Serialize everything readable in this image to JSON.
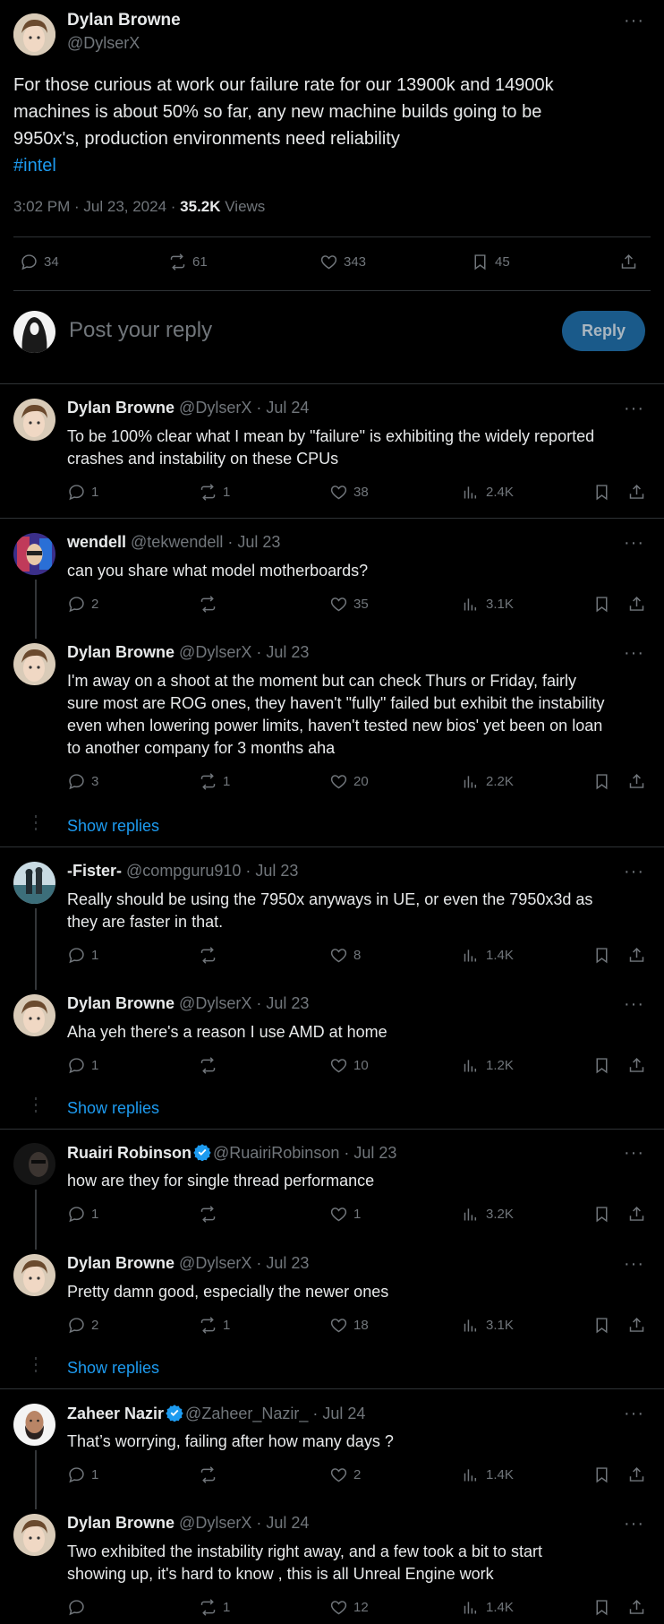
{
  "main": {
    "author_name": "Dylan Browne",
    "author_handle": "@DylserX",
    "text_line1": "For those curious at work our failure rate for our 13900k and 14900k",
    "text_line2": "machines is about 50% so far, any new machine builds going to be",
    "text_line3": "9950x's, production environments need reliability",
    "hashtag": "#intel",
    "time": "3:02 PM · Jul 23, 2024 · ",
    "views_count": "35.2K",
    "views_label": " Views",
    "replies": "34",
    "reposts": "61",
    "likes": "343",
    "bookmarks": "45"
  },
  "composer": {
    "placeholder": "Post your reply",
    "reply_button": "Reply"
  },
  "show_replies_label": "Show replies",
  "replies": [
    {
      "name": "Dylan Browne",
      "handle": "@DylserX · Jul 24",
      "lines": [
        "To be 100% clear what I mean by \"failure\" is exhibiting the widely reported",
        "crashes and instability on these CPUs"
      ],
      "reply_count": "1",
      "repost_count": "1",
      "like_count": "38",
      "view_count": "2.4K"
    },
    {
      "name": "wendell",
      "handle": "@tekwendell · Jul 23",
      "lines": [
        "can you share what model motherboards?"
      ],
      "reply_count": "2",
      "repost_count": "",
      "like_count": "35",
      "view_count": "3.1K"
    },
    {
      "name": "Dylan Browne",
      "handle": "@DylserX · Jul 23",
      "lines": [
        "I'm away on a shoot at the moment but can check Thurs or Friday, fairly",
        "sure most are ROG ones, they haven't \"fully\" failed but exhibit the instability",
        "even when lowering power limits, haven't tested new bios' yet been on loan",
        "to another company for 3 months aha"
      ],
      "reply_count": "3",
      "repost_count": "1",
      "like_count": "20",
      "view_count": "2.2K"
    },
    {
      "name": "-Fister-",
      "handle": "@compguru910 · Jul 23",
      "lines": [
        "Really should be using the 7950x anyways in UE, or even the 7950x3d as",
        "they are faster in that."
      ],
      "reply_count": "1",
      "repost_count": "",
      "like_count": "8",
      "view_count": "1.4K"
    },
    {
      "name": "Dylan Browne",
      "handle": "@DylserX · Jul 23",
      "lines": [
        "Aha yeh there's a reason I use AMD at home"
      ],
      "reply_count": "1",
      "repost_count": "",
      "like_count": "10",
      "view_count": "1.2K"
    },
    {
      "name": "Ruairi Robinson",
      "handle": "@RuairiRobinson · Jul 23",
      "lines": [
        "how are they for single thread performance"
      ],
      "reply_count": "1",
      "repost_count": "",
      "like_count": "1",
      "view_count": "3.2K"
    },
    {
      "name": "Dylan Browne",
      "handle": "@DylserX · Jul 23",
      "lines": [
        "Pretty damn good, especially the newer ones"
      ],
      "reply_count": "2",
      "repost_count": "1",
      "like_count": "18",
      "view_count": "3.1K"
    },
    {
      "name": "Zaheer Nazir",
      "handle": "@Zaheer_Nazir_ · Jul 24",
      "lines": [
        "That’s worrying, failing after how many days ?"
      ],
      "reply_count": "1",
      "repost_count": "",
      "like_count": "2",
      "view_count": "1.4K"
    },
    {
      "name": "Dylan Browne",
      "handle": "@DylserX · Jul 24",
      "lines": [
        "Two exhibited the instability right away, and a few took a bit to start",
        "showing up, it's hard to know , this is all Unreal Engine work"
      ],
      "reply_count": "",
      "repost_count": "1",
      "like_count": "12",
      "view_count": "1.4K"
    }
  ],
  "colors": {
    "accent": "#1d9bf0",
    "reply_button_bg": "#1a5a8a",
    "divider": "#2f3336"
  }
}
